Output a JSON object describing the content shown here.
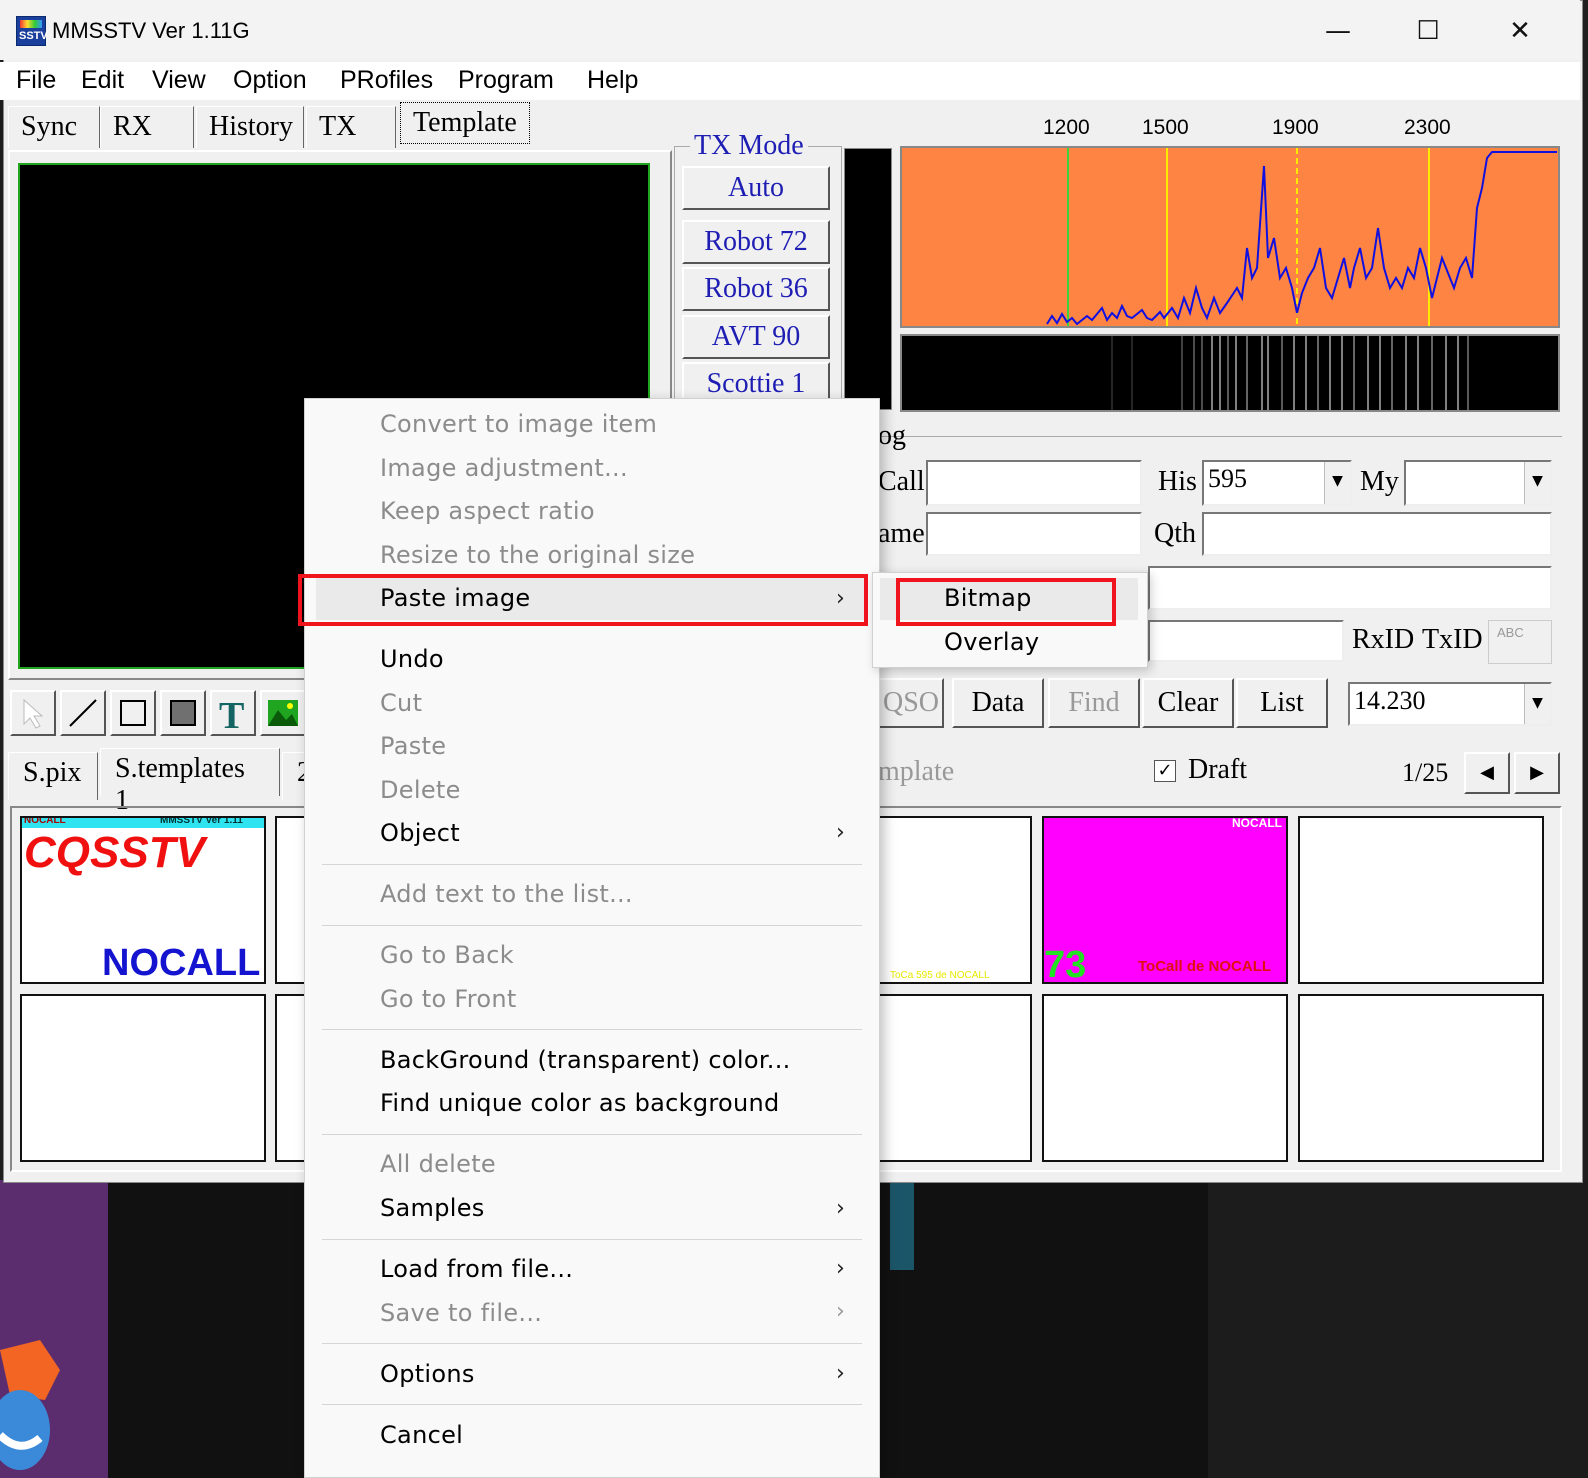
{
  "window": {
    "title": "MMSSTV Ver 1.11G",
    "icon_label": "SSTV"
  },
  "menubar": [
    "File",
    "Edit",
    "View",
    "Option",
    "PRofiles",
    "Program",
    "Help"
  ],
  "tabs": [
    "Sync",
    "RX",
    "History",
    "TX",
    "Template"
  ],
  "active_tab": "Template",
  "tx_mode": {
    "label": "TX Mode",
    "buttons": [
      "Auto",
      "Robot 72",
      "Robot 36",
      "AVT 90",
      "Scottie 1"
    ]
  },
  "spectrum": {
    "freq_labels": [
      "1200",
      "1500",
      "1900",
      "2300"
    ],
    "bg_color": "#fe8444",
    "trace_color": "#1010e0"
  },
  "log": {
    "section_label": "og",
    "call_label": "Call",
    "his_label": "His",
    "his_value": "595",
    "my_label": "My",
    "name_label": "ame",
    "qth_label": "Qth",
    "rxid": "RxID",
    "txid": "TxID",
    "abc": "ABC",
    "buttons": [
      "QSO",
      "Data",
      "Find",
      "Clear",
      "List"
    ],
    "freq_value": "14.230"
  },
  "bottom": {
    "tabs": [
      "S.pix",
      "S.templates 1",
      "2"
    ],
    "template_label": "mplate",
    "draft_label": "Draft",
    "draft_checked": true,
    "page": "1/25"
  },
  "thumbs": {
    "t1_top_left": "NOCALL",
    "t1_top_right": "MMSSTV Ver 1.11",
    "t1_main": "CQSSTV",
    "t1_call": "NOCALL",
    "t3_bottom": "ToCa  595 de NOCALL",
    "t4_top": "NOCALL",
    "t4_num": "73",
    "t4_bottom": "ToCall de NOCALL"
  },
  "context_menu": {
    "items": [
      {
        "label": "Convert to image item",
        "disabled": true
      },
      {
        "label": "Image adjustment...",
        "disabled": true
      },
      {
        "label": "Keep aspect ratio",
        "disabled": true
      },
      {
        "label": "Resize to the original size",
        "disabled": true
      },
      {
        "label": "Paste image",
        "disabled": false
      },
      {
        "label": "Undo",
        "disabled": false
      },
      {
        "label": "Cut",
        "disabled": true
      },
      {
        "label": "Paste",
        "disabled": true
      },
      {
        "label": "Delete",
        "disabled": true
      },
      {
        "label": "Object",
        "disabled": false
      },
      {
        "label": "Add text to the list...",
        "disabled": true
      },
      {
        "label": "Go to Back",
        "disabled": true
      },
      {
        "label": "Go to Front",
        "disabled": true
      },
      {
        "label": "BackGround (transparent) color...",
        "disabled": false
      },
      {
        "label": "Find unique color as background",
        "disabled": false
      },
      {
        "label": "All delete",
        "disabled": true
      },
      {
        "label": "Samples",
        "disabled": false
      },
      {
        "label": "Load from file...",
        "disabled": false
      },
      {
        "label": "Save to file...",
        "disabled": true
      },
      {
        "label": "Options",
        "disabled": false
      },
      {
        "label": "Cancel",
        "disabled": false
      }
    ],
    "submenu": [
      "Bitmap",
      "Overlay"
    ],
    "highlight_color": "#f0141e"
  }
}
